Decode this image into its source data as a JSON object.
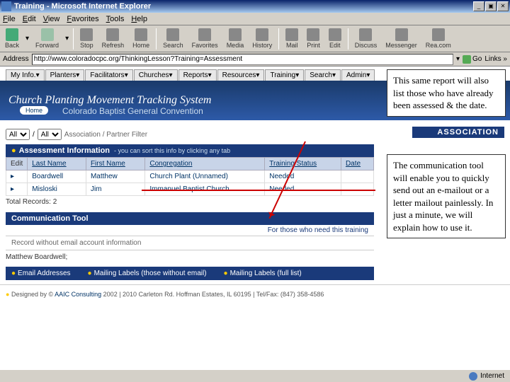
{
  "window": {
    "title": "Training - Microsoft Internet Explorer",
    "min": "_",
    "max": "▣",
    "close": "✕"
  },
  "menu": [
    "File",
    "Edit",
    "View",
    "Favorites",
    "Tools",
    "Help"
  ],
  "toolbar": {
    "back": "Back",
    "forward": "Forward",
    "stop": "Stop",
    "refresh": "Refresh",
    "home": "Home",
    "search": "Search",
    "favorites": "Favorites",
    "media": "Media",
    "history": "History",
    "mail": "Mail",
    "print": "Print",
    "edit": "Edit",
    "discuss": "Discuss",
    "messenger": "Messenger",
    "realcom": "Rea.com"
  },
  "address": {
    "label": "Address",
    "url": "http://www.coloradocpc.org/ThinkingLesson?Training=Assessment",
    "go": "Go",
    "links": "Links »"
  },
  "tabs": [
    "My Info.",
    "Planters",
    "Facilitators",
    "Churches",
    "Reports",
    "Resources",
    "Training",
    "Search",
    "Admin"
  ],
  "banner": {
    "title": "Church Planting Movement Tracking System",
    "subtitle": "Colorado Baptist General Convention",
    "home": "Home"
  },
  "filter": {
    "all1": "All",
    "all2": "All",
    "label": "Association / Partner Filter",
    "header": "ASSOCIATION"
  },
  "assessment": {
    "title": "Assessment Information",
    "hint": "- you can sort this info by clicking any tab",
    "cols": {
      "edit": "Edit",
      "last": "Last Name",
      "first": "First Name",
      "cong": "Congregation",
      "status": "Training Status",
      "date": "Date"
    },
    "rows": [
      {
        "last": "Boardwell",
        "first": "Matthew",
        "cong": "Church Plant (Unnamed)",
        "status": "Needed",
        "date": ""
      },
      {
        "last": "Misloski",
        "first": "Jim",
        "cong": "Immanuel Baptist Church",
        "status": "Needed",
        "date": ""
      }
    ],
    "total_label": "Total Records:",
    "total": "2"
  },
  "comm": {
    "title": "Communication Tool",
    "sub": "For those who need this training",
    "sub2": "Record without email account information",
    "names": "Matthew Boardwell;",
    "btns": [
      "Email Addresses",
      "Mailing Labels (those without email)",
      "Mailing Labels (full list)"
    ]
  },
  "footer": {
    "text": "Designed by © ",
    "link": "AAIC Consulting",
    "rest": " 2002 | 2010 Carleton Rd. Hoffman Estates, IL 60195 | Tel/Fax: (847) 358-4586"
  },
  "status": {
    "text": "Internet"
  },
  "annotations": {
    "a1": "This same report will also list those who have already been assessed & the date.",
    "a2": "The communication tool will enable you to quickly send out an e-mailout or a letter mailout painlessly.  In just a minute, we will explain how to use it."
  }
}
